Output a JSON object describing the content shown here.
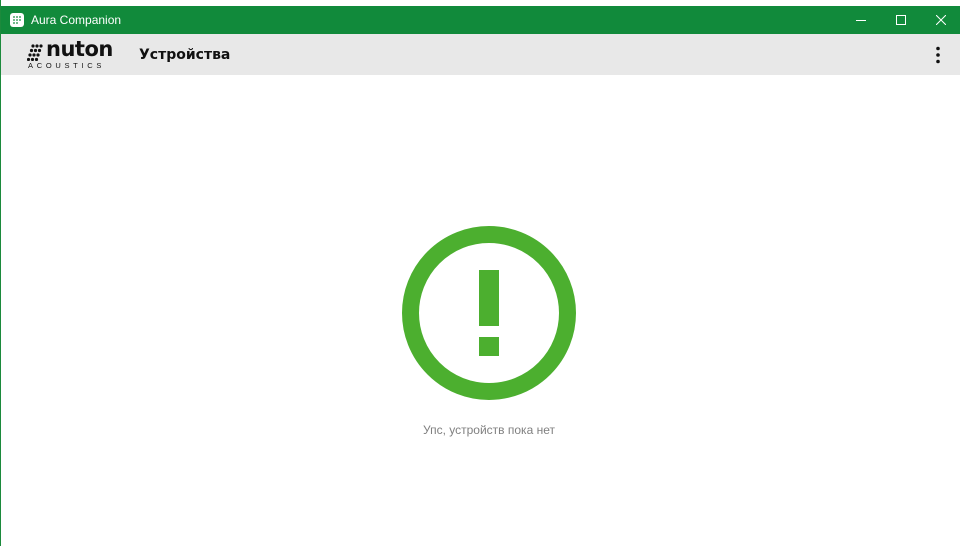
{
  "window": {
    "title": "Aura Companion",
    "titlebar_color": "#118a3b",
    "app_icon": "aura-app-icon",
    "controls": {
      "minimize": "minimize-icon",
      "maximize": "maximize-icon",
      "close": "close-icon"
    }
  },
  "header": {
    "logo": {
      "brand": "nuton",
      "subtitle": "ACOUSTICS"
    },
    "title": "Устройства",
    "menu_icon": "more-vertical-icon",
    "background": "#e8e8e8"
  },
  "empty_state": {
    "icon": "exclamation-circle-icon",
    "icon_color": "#4caf2f",
    "message": "Упс, устройств пока нет"
  }
}
